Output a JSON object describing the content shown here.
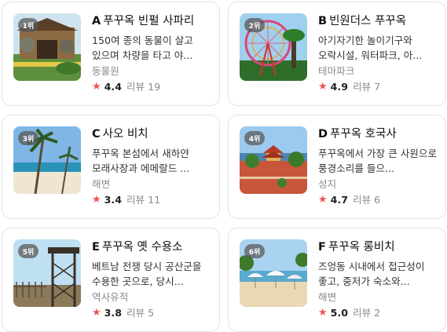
{
  "review_word": "리뷰",
  "places": [
    {
      "rank": "1위",
      "letter": "A",
      "name": "푸꾸옥 빈펄 사파리",
      "description": "150여 종의 동물이 살고 있으며 차량을 타고 야...",
      "category": "동물원",
      "rating": "4.4",
      "reviews": "19",
      "thumbnail": "safari-gate"
    },
    {
      "rank": "2위",
      "letter": "B",
      "name": "빈원더스 푸꾸옥",
      "description": "아기자기한 놀이기구와 오락시설, 워터파크, 아...",
      "category": "테마파크",
      "rating": "4.9",
      "reviews": "7",
      "thumbnail": "ferris-wheel"
    },
    {
      "rank": "3위",
      "letter": "C",
      "name": "사오 비치",
      "description": "푸꾸옥 본섬에서 새하얀 모래사장과 에메랄드 ...",
      "category": "해변",
      "rating": "3.4",
      "reviews": "11",
      "thumbnail": "palm-beach"
    },
    {
      "rank": "4위",
      "letter": "D",
      "name": "푸꾸옥 호국사",
      "description": "푸꾸옥에서 가장 큰 사원으로 풍경소리를 들으...",
      "category": "성지",
      "rating": "4.7",
      "reviews": "6",
      "thumbnail": "temple"
    },
    {
      "rank": "5위",
      "letter": "E",
      "name": "푸꾸옥 옛 수용소",
      "description": "베트남 전쟁 당시 공산군을 수용한 곳으로, 당시...",
      "category": "역사유적",
      "rating": "3.8",
      "reviews": "5",
      "thumbnail": "prison-tower"
    },
    {
      "rank": "6위",
      "letter": "F",
      "name": "푸꾸옥 롱비치",
      "description": "즈엉동 시내에서 접근성이 좋고, 중저가 숙소와...",
      "category": "해변",
      "rating": "5.0",
      "reviews": "2",
      "thumbnail": "umbrella-beach"
    }
  ]
}
